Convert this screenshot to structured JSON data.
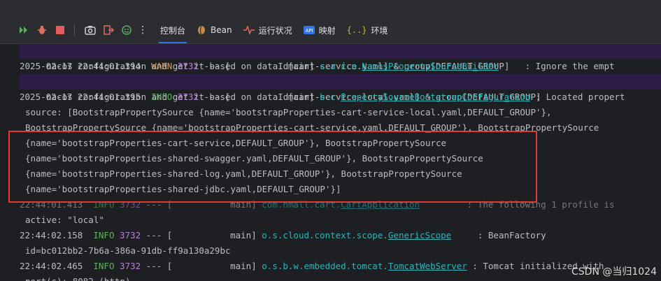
{
  "toolbar": {
    "tabs": [
      {
        "label": "控制台",
        "icon": "console-icon"
      },
      {
        "label": "Bean",
        "icon": "bean-icon"
      },
      {
        "label": "运行状况",
        "icon": "health-icon"
      },
      {
        "label": "映射",
        "icon": "mappings-icon"
      },
      {
        "label": "环境",
        "icon": "environment-icon"
      }
    ],
    "buttons": [
      "rerun-icon",
      "debug-icon",
      "stop-icon",
      "screenshot-icon",
      "exit-icon",
      "coverage-icon",
      "more-icon"
    ]
  },
  "colors": {
    "warn": "#c9a26d",
    "info": "#5fb05f",
    "pid": "#b77fd8",
    "class": "#2fb4b9",
    "highlight": "#2d1c47",
    "redbox": "#e53935"
  },
  "log": {
    "l1": "nacos configuration and get it based on dataId[cart-service.yaml] & group[DEFAULT_GROUP]",
    "l2": {
      "ts": "2025-02-17 22:44:01.394",
      "level": "WARN",
      "pid": "3732",
      "sep": "--- [",
      "thread": "main]",
      "logger_prefix": "c.a.c.n.",
      "logger_name": "NacosPropertySourceBuilder",
      "msg": ": Ignore the empt"
    },
    "l3": "nacos configuration and get it based on dataId[cart-service-local.yaml] & group[DEFAULT_GROUP]",
    "l4": {
      "ts": "2025-02-17 22:44:01.395",
      "level": "INFO",
      "pid": "3732",
      "sep": "--- [",
      "thread": "main]",
      "logger_prefix": "b.c.",
      "logger_name": "PropertySourceBootstrapConfiguration",
      "msg": ": Located propert"
    },
    "l5": "source: [BootstrapPropertySource {name='bootstrapProperties-cart-service-local.yaml,DEFAULT_GROUP'},",
    "l6": "BootstrapPropertySource {name='bootstrapProperties-cart-service.yaml,DEFAULT_GROUP'}, BootstrapPropertySource",
    "l7": "{name='bootstrapProperties-cart-service,DEFAULT_GROUP'}, BootstrapPropertySource",
    "l8": "{name='bootstrapProperties-shared-swagger.yaml,DEFAULT_GROUP'}, BootstrapPropertySource",
    "l9": "{name='bootstrapProperties-shared-log.yaml,DEFAULT_GROUP'}, BootstrapPropertySource",
    "l10": "{name='bootstrapProperties-shared-jdbc.yaml,DEFAULT_GROUP'}]",
    "l11": {
      "ts": "22:44:01.413",
      "level": "INFO",
      "pid": "3732",
      "sep": "--- [",
      "thread": "main]",
      "logger_prefix": "com.hmall.cart.",
      "logger_name": "CartApplication",
      "msg": ": The following 1 profile is"
    },
    "l12": "active: \"local\"",
    "l13": {
      "ts": "22:44:02.158",
      "level": "INFO",
      "pid": "3732",
      "sep": "--- [",
      "thread": "main]",
      "logger_prefix": "o.s.cloud.context.scope.",
      "logger_name": "GenericScope",
      "msg": ": BeanFactory"
    },
    "l14": "id=bc012bb2-7b6a-386a-91db-ff9a130a29bc",
    "l15": {
      "ts": "22:44:02.465",
      "level": "INFO",
      "pid": "3732",
      "sep": "--- [",
      "thread": "main]",
      "logger_prefix": "o.s.b.w.embedded.tomcat.",
      "logger_name": "TomcatWebServer",
      "msg": ": Tomcat initialized with"
    },
    "l16": "port(s): 8082 (http)"
  },
  "watermark": "CSDN @当归1024"
}
